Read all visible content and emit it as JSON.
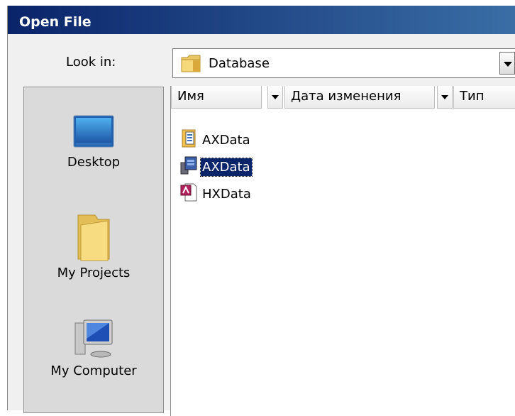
{
  "window": {
    "title": "Open File"
  },
  "lookin": {
    "label": "Look in:",
    "value": "Database"
  },
  "places": [
    {
      "label": "Desktop",
      "icon": "desktop-icon"
    },
    {
      "label": "My Projects",
      "icon": "folder-icon"
    },
    {
      "label": "My Computer",
      "icon": "computer-icon"
    }
  ],
  "columns": [
    {
      "label": "Имя"
    },
    {
      "label": "Дата изменения"
    },
    {
      "label": "Тип"
    }
  ],
  "files": [
    {
      "name": "AXData",
      "icon": "database-project-icon",
      "selected": false
    },
    {
      "name": "AXData",
      "icon": "database-server-icon",
      "selected": true
    },
    {
      "name": "HXData",
      "icon": "access-file-icon",
      "selected": false
    }
  ],
  "colors": {
    "titlebar": "#0a246a",
    "selection": "#0a246a",
    "places_bg": "#dadada"
  }
}
